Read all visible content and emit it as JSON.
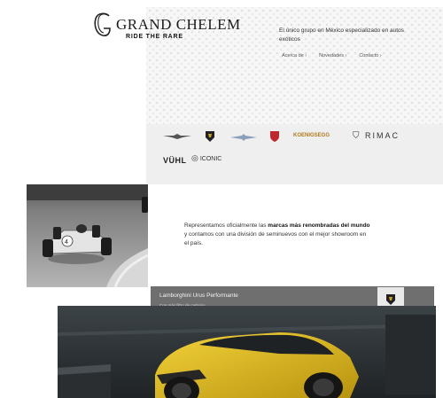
{
  "header": {
    "logo_title": "GRAND CHELEM",
    "logo_tagline": "RIDE THE RARE",
    "tagline": "El único grupo en México especializado en autos exóticos",
    "nav": [
      "Acerca de ›",
      "Novedades ›",
      "Contacto ›"
    ]
  },
  "brands": {
    "koenigsegg": "KOENIGSEGG",
    "rimac": "RIMAC",
    "vuhl": "VÜHL",
    "iconic": "ICONIC"
  },
  "description": {
    "part1": "Representamos oficialmente las ",
    "bold1": "marcas más renombradas del mundo",
    "part2": " y contamos con una división de seminuevos con el mejor showroom en el país."
  },
  "featured": {
    "title": "Lamborghini Urus Performante",
    "subtitle": "Con más filtro de carbono"
  },
  "colors": {
    "feature_bar": "#6f6f6f",
    "car": "#e8c21a"
  }
}
